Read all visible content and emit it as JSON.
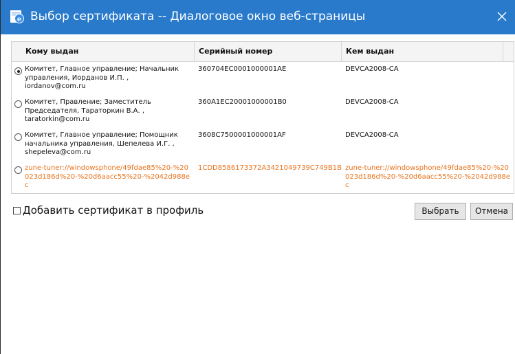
{
  "window": {
    "title": "Выбор сертификата -- Диалоговое окно веб-страницы",
    "title_bar_color": "#2a7acb",
    "icon": "internet-explorer-icon",
    "close_icon": "close-icon"
  },
  "table": {
    "columns": [
      "Кому выдан",
      "Серийный номер",
      "Кем выдан"
    ],
    "rows": [
      {
        "selected": true,
        "issued_to": "Комитет, Главное управление; Начальник управления, Иорданов И.П. , iordanov@com.ru",
        "serial": "360704EC0001000001AE",
        "issued_by": "DEVCA2008-CA"
      },
      {
        "selected": false,
        "issued_to": "Комитет, Правление; Заместитель Председателя, Тараторкин В.А. , taratorkin@com.ru",
        "serial": "360A1EC20001000001B0",
        "issued_by": "DEVCA2008-CA"
      },
      {
        "selected": false,
        "issued_to": "Комитет, Главное управление; Помощник начальника управления, Шепелева И.Г. , shepeleva@com.ru",
        "serial": "3608C7500001000001AF",
        "issued_by": "DEVCA2008-CA"
      },
      {
        "selected": false,
        "issued_to": "zune-tuner://windowsphone/49fdae85%20-%20023d186d%20-%20d6aacc55%20-%2042d988ec",
        "serial": "1CDD8586173372A3421049739C749B1B",
        "issued_by": "zune-tuner://windowsphone/49fdae85%20-%20023d186d%20-%20d6aacc55%20-%2042d988ec",
        "link_color": "#e8731d"
      }
    ]
  },
  "add_to_profile": {
    "label": "Добавить сертификат в профиль",
    "checked": false
  },
  "buttons": {
    "select": "Выбрать",
    "cancel": "Отмена"
  }
}
